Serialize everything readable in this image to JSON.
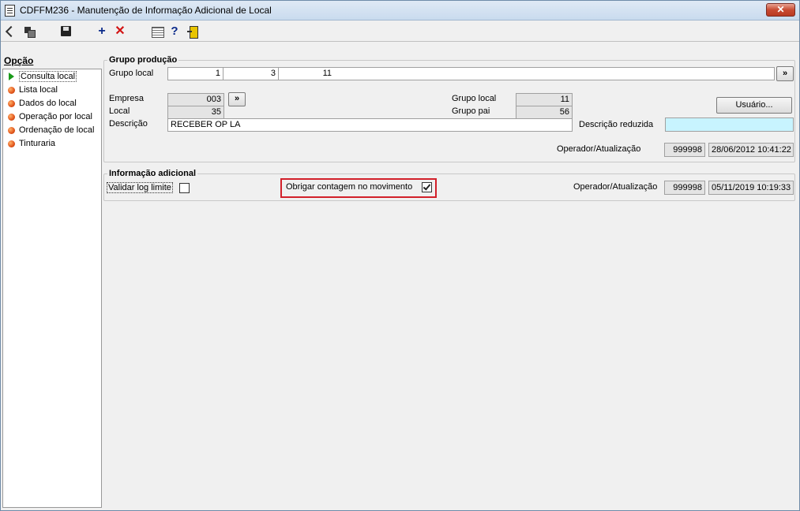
{
  "window": {
    "title": "CDFFM236 - Manutenção de Informação Adicional de Local",
    "close_label": "✕"
  },
  "toolbar": {
    "icons": [
      "first-record-icon",
      "copy-icon",
      "save-icon",
      "add-icon",
      "delete-icon",
      "grid-icon",
      "help-icon",
      "exit-icon"
    ],
    "add_label": "+",
    "delete_label": "✕",
    "help_label": "?"
  },
  "sidebar": {
    "heading": "Opção",
    "items": [
      {
        "label": "Consulta local",
        "selected": true
      },
      {
        "label": "Lista local"
      },
      {
        "label": "Dados do local"
      },
      {
        "label": "Operação por local"
      },
      {
        "label": "Ordenação de local"
      },
      {
        "label": "Tinturaria"
      }
    ]
  },
  "grupo_producao": {
    "title": "Grupo produção",
    "grupo_local_label": "Grupo local",
    "grupo_local_values": [
      "1",
      "3",
      "11"
    ],
    "expand_label": "»",
    "empresa_label": "Empresa",
    "empresa_value": "003",
    "empresa_btn_label": "»",
    "local_label": "Local",
    "local_value": "35",
    "descricao_label": "Descrição",
    "descricao_value": "RECEBER OP LA",
    "grupo_local2_label": "Grupo local",
    "grupo_local2_value": "11",
    "grupo_pai_label": "Grupo pai",
    "grupo_pai_value": "56",
    "descricao_reduzida_label": "Descrição reduzida",
    "descricao_reduzida_value": "",
    "usuario_btn_label": "Usuário...",
    "operador_label": "Operador/Atualização",
    "operador_value": "999998",
    "atualizacao_value": "28/06/2012 10:41:22"
  },
  "informacao_adicional": {
    "title": "Informação adicional",
    "validar_label": "Validar log limite",
    "validar_checked": false,
    "obrigar_label": "Obrigar contagem no movimento",
    "obrigar_checked": true,
    "highlight_color": "#d2202a",
    "operador_label": "Operador/Atualização",
    "operador_value": "999998",
    "atualizacao_value": "05/11/2019 10:19:33"
  }
}
